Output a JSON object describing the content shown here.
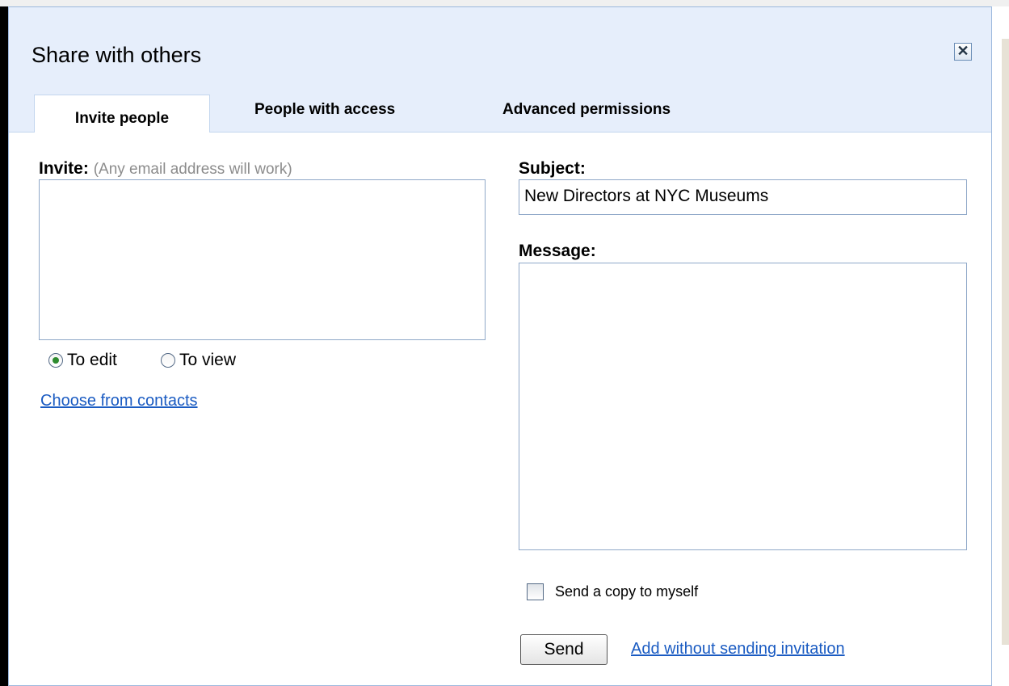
{
  "dialog": {
    "title": "Share with others",
    "close_icon": "close-icon"
  },
  "tabs": [
    {
      "label": "Invite people",
      "active": true
    },
    {
      "label": "People with access",
      "active": false
    },
    {
      "label": "Advanced permissions",
      "active": false
    }
  ],
  "invite": {
    "label": "Invite:",
    "hint": "(Any email address will work)",
    "value": "",
    "radio_edit": "To edit",
    "radio_view": "To view",
    "selected": "To edit",
    "contacts_link": "Choose from contacts"
  },
  "subject": {
    "label": "Subject:",
    "value": "New Directors at NYC Museums"
  },
  "message": {
    "label": "Message:",
    "value": ""
  },
  "copy_checkbox": {
    "label": "Send a copy to myself",
    "checked": false
  },
  "actions": {
    "send_label": "Send",
    "add_without_label": "Add without sending invitation"
  },
  "colors": {
    "header_bg": "#e6eefb",
    "link": "#1a5bc2",
    "border": "#8fa8c8"
  }
}
